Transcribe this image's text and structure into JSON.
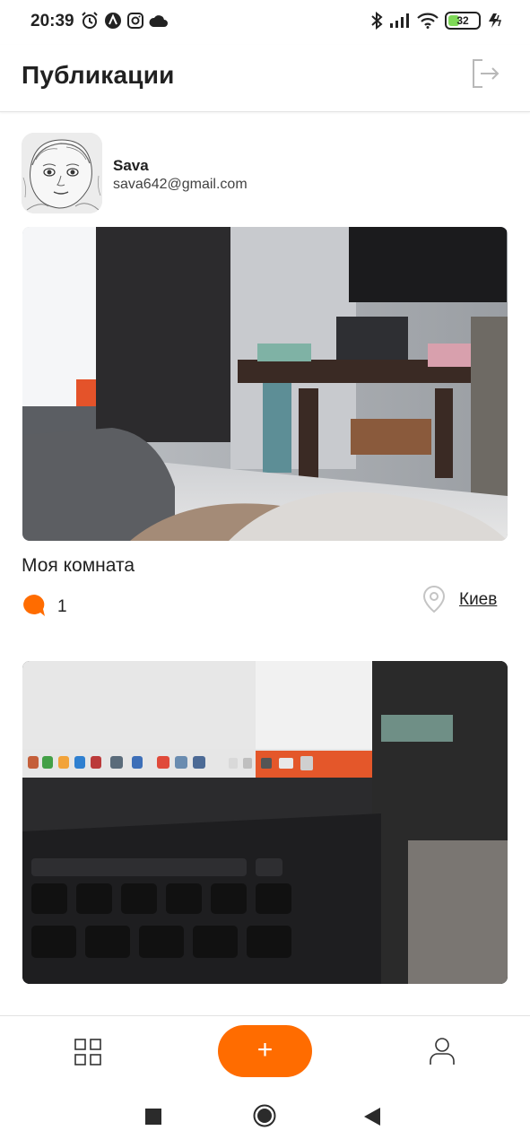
{
  "status_bar": {
    "time": "20:39",
    "battery_level": "32",
    "icons": [
      "alarm-icon",
      "nav-a-icon",
      "instagram-icon",
      "cloud-icon",
      "bluetooth-icon",
      "signal-icon",
      "wifi-icon",
      "battery-icon",
      "charging-icon"
    ]
  },
  "header": {
    "title": "Публикации",
    "logout_icon": "logout-icon"
  },
  "user": {
    "name": "Sava",
    "email": "sava642@gmail.com"
  },
  "posts": [
    {
      "title": "Моя комната",
      "comments_count": "1",
      "location": "Киев"
    },
    {
      "title": ""
    }
  ],
  "tab_bar": {
    "add_label": "+",
    "icons": [
      "grid-icon",
      "plus-icon",
      "user-icon"
    ]
  },
  "colors": {
    "accent": "#FF6C00",
    "text": "#212121",
    "border": "#E3E3E3"
  }
}
